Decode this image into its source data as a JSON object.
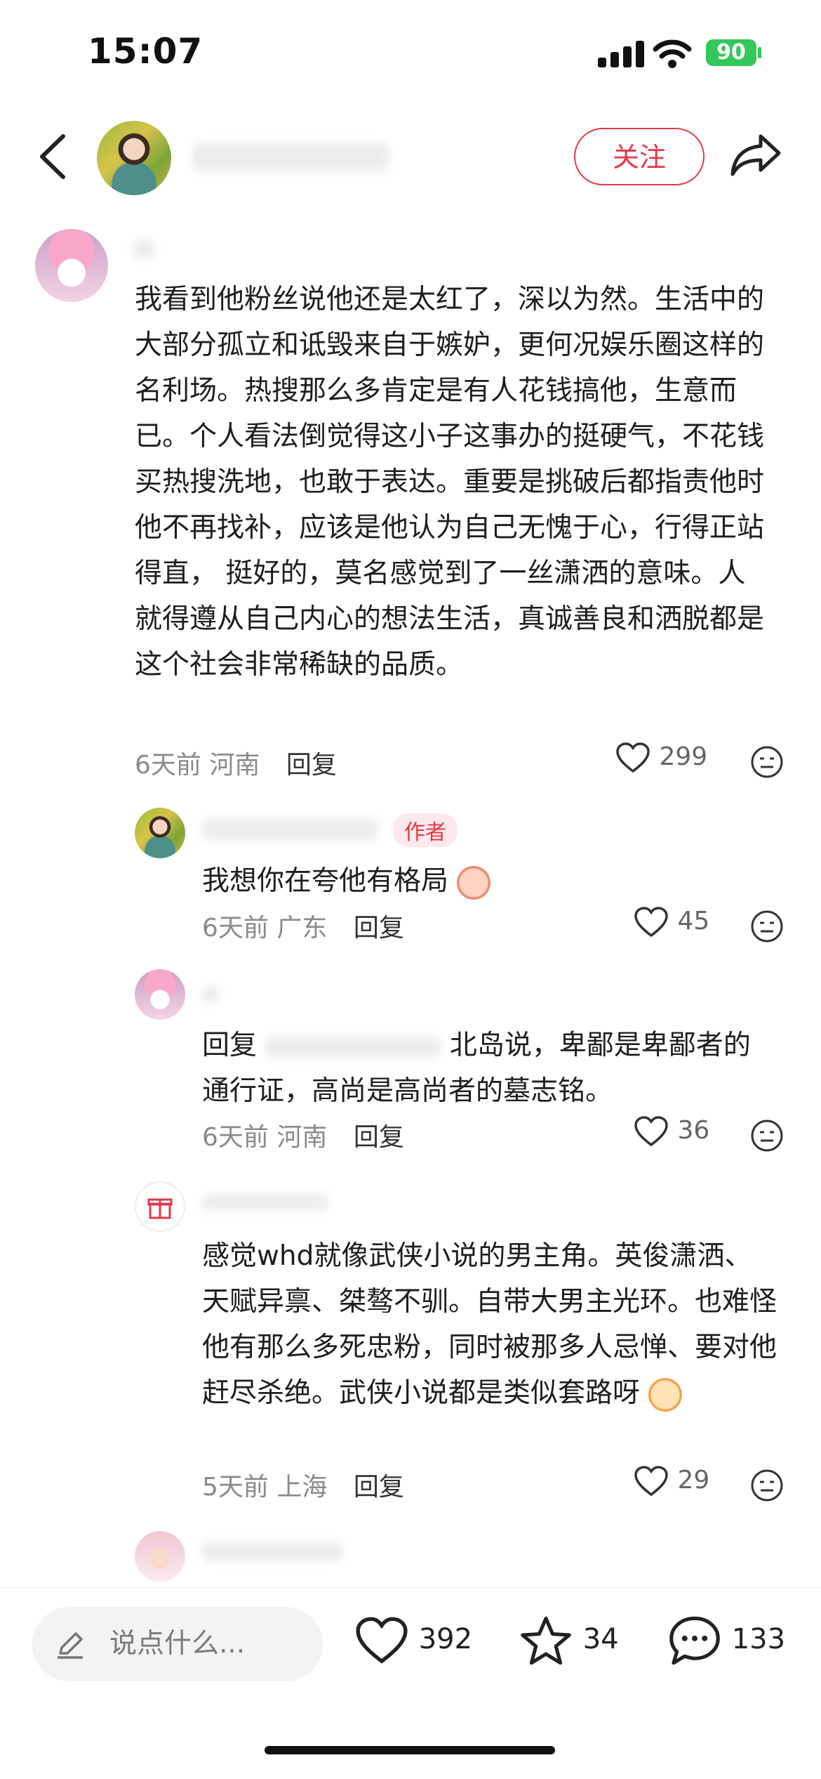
{
  "status": {
    "time": "15:07",
    "battery": "90"
  },
  "header": {
    "follow_label": "关注"
  },
  "comments": [
    {
      "text": "我看到他粉丝说他还是太红了，深以为然。生活中的大部分孤立和诋毁来自于嫉妒，更何况娱乐圈这样的名利场。热搜那么多肯定是有人花钱搞他，生意而已。个人看法倒觉得这小子这事办的挺硬气，不花钱买热搜洗地，也敢于表达。重要是挑破后都指责他时他不再找补，应该是他认为自己无愧于心，行得正站得直， 挺好的，莫名感觉到了一丝潇洒的意味。人就得遵从自己内心的想法生活，真诚善良和洒脱都是这个社会非常稀缺的品质。",
      "time": "6天前",
      "location": "河南",
      "reply": "回复",
      "likes": "299"
    }
  ],
  "replies": [
    {
      "tag": "作者",
      "text": "我想你在夸他有格局",
      "time": "6天前",
      "location": "广东",
      "reply": "回复",
      "likes": "45"
    },
    {
      "text_prefix": "回复",
      "text": "北岛说，卑鄙是卑鄙者的通行证，高尚是高尚者的墓志铭。",
      "time": "6天前",
      "location": "河南",
      "reply": "回复",
      "likes": "36"
    },
    {
      "text": "感觉whd就像武侠小说的男主角。英俊潇洒、天赋异禀、桀骜不驯。自带大男主光环。也难怪他有那么多死忠粉，同时被那多人忌惮、要对他赶尽杀绝。武侠小说都是类似套路呀",
      "time": "5天前",
      "location": "上海",
      "reply": "回复",
      "likes": "29"
    }
  ],
  "bottom": {
    "input_placeholder": "说点什么...",
    "likes": "392",
    "stars": "34",
    "comments": "133"
  }
}
